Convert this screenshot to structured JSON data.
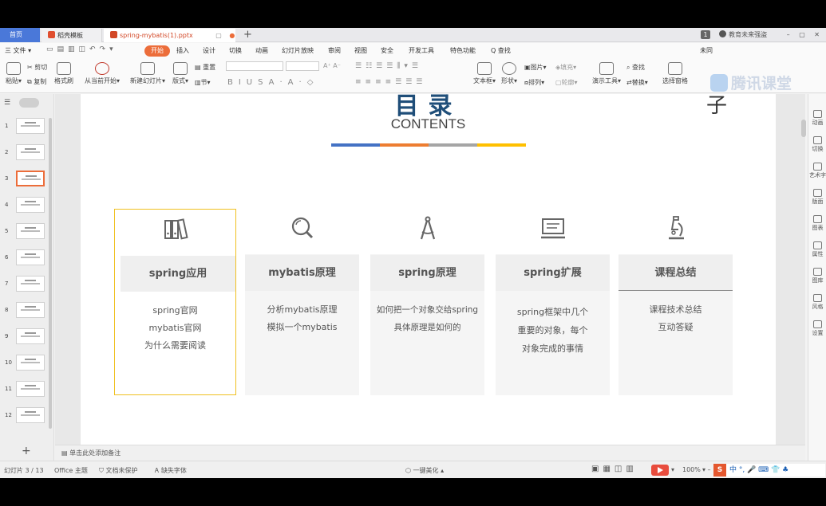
{
  "tabs": {
    "home": "首页",
    "template": "稻壳模板",
    "file": "spring-mybatis(1).pptx"
  },
  "titlebar_right": {
    "page_indicator": "1",
    "user": "教育未来强盗"
  },
  "menu": {
    "file": "三 文件 ▾",
    "items": [
      "开始",
      "插入",
      "设计",
      "切换",
      "动画",
      "幻灯片放映",
      "审阅",
      "视图",
      "安全",
      "开发工具",
      "特色功能",
      "Q 查找"
    ],
    "active": "开始",
    "right_text": "未同"
  },
  "ribbon": {
    "paste": "粘贴▾",
    "cut": "剪切",
    "copy": "复制",
    "format_painter": "格式刷",
    "from_current": "从当前开始▾",
    "new_slide": "新建幻灯片▾",
    "layout": "版式▾",
    "section": "节▾",
    "reset": "重置",
    "textbox": "文本框▾",
    "shape": "形状▾",
    "picture": "图片▾",
    "fill": "填充▾",
    "arrange": "排列▾",
    "outline": "轮廓▾",
    "presentation_tools": "演示工具▾",
    "find": "查找",
    "replace": "替换▾",
    "select_pane": "选择窗格"
  },
  "watermark": "腾讯课堂",
  "thumbnails": {
    "numbers": [
      "1",
      "2",
      "3",
      "4",
      "5",
      "6",
      "7",
      "8",
      "9",
      "10",
      "11",
      "12"
    ],
    "selected": 3
  },
  "slide": {
    "title": "目录",
    "subtitle": "CONTENTS",
    "corner_text": "子",
    "bar_colors": [
      "#4472c4",
      "#ed7d31",
      "#a5a5a5",
      "#ffc000"
    ],
    "cards": [
      {
        "icon": "books-icon",
        "heading": "spring应用",
        "lines": [
          "spring官网",
          "mybatis官网",
          "为什么需要阅读"
        ]
      },
      {
        "icon": "magnifier-icon",
        "heading": "mybatis原理",
        "lines": [
          "分析mybatis原理",
          "模拟一个mybatis"
        ]
      },
      {
        "icon": "compass-icon",
        "heading": "spring原理",
        "lines": [
          "如何把一个对象交给spring",
          "具体原理是如何的"
        ]
      },
      {
        "icon": "monitor-icon",
        "heading": "spring扩展",
        "lines": [
          "spring框架中几个",
          "重要的对象，每个",
          "对象完成的事情"
        ]
      },
      {
        "icon": "microscope-icon",
        "heading": "课程总结",
        "lines": [
          "课程技术总结",
          "互动答疑"
        ]
      }
    ]
  },
  "notes_placeholder": "单击此处添加备注",
  "right_sidebar": [
    "动画",
    "切换",
    "艺术字",
    "版面",
    "图表",
    "属性",
    "图库",
    "风格",
    "设置"
  ],
  "status": {
    "slide_counter": "幻灯片 3 / 13",
    "theme": "Office 主题",
    "protect": "文档未保护",
    "missing_font": "缺失字体",
    "beautify": "一键美化 ▴",
    "zoom": "100%",
    "ime": "中 °, 🎤 ⌨ 👕 ♣"
  }
}
